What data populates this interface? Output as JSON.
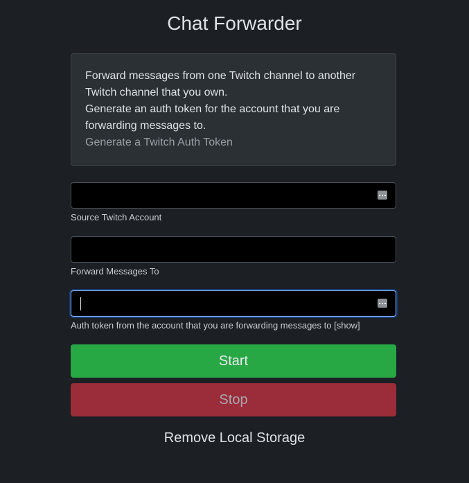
{
  "page": {
    "title": "Chat Forwarder"
  },
  "info": {
    "line1": "Forward messages from one Twitch channel to another Twitch channel that you own.",
    "line2": "Generate an auth token for the account that you are forwarding messages to.",
    "link_label": "Generate a Twitch Auth Token"
  },
  "form": {
    "source": {
      "value": "",
      "help": "Source Twitch Account"
    },
    "target": {
      "value": "",
      "help": "Forward Messages To"
    },
    "token": {
      "value": "",
      "help": "Auth token from the account that you are forwarding messages to [show]"
    }
  },
  "buttons": {
    "start_label": "Start",
    "stop_label": "Stop",
    "remove_label": "Remove Local Storage"
  },
  "colors": {
    "background": "#1c1f24",
    "start": "#28a745",
    "stop": "#9b2c3a",
    "focus": "#86b7fe"
  },
  "icons": {
    "field_menu": "more-horizontal-icon"
  }
}
